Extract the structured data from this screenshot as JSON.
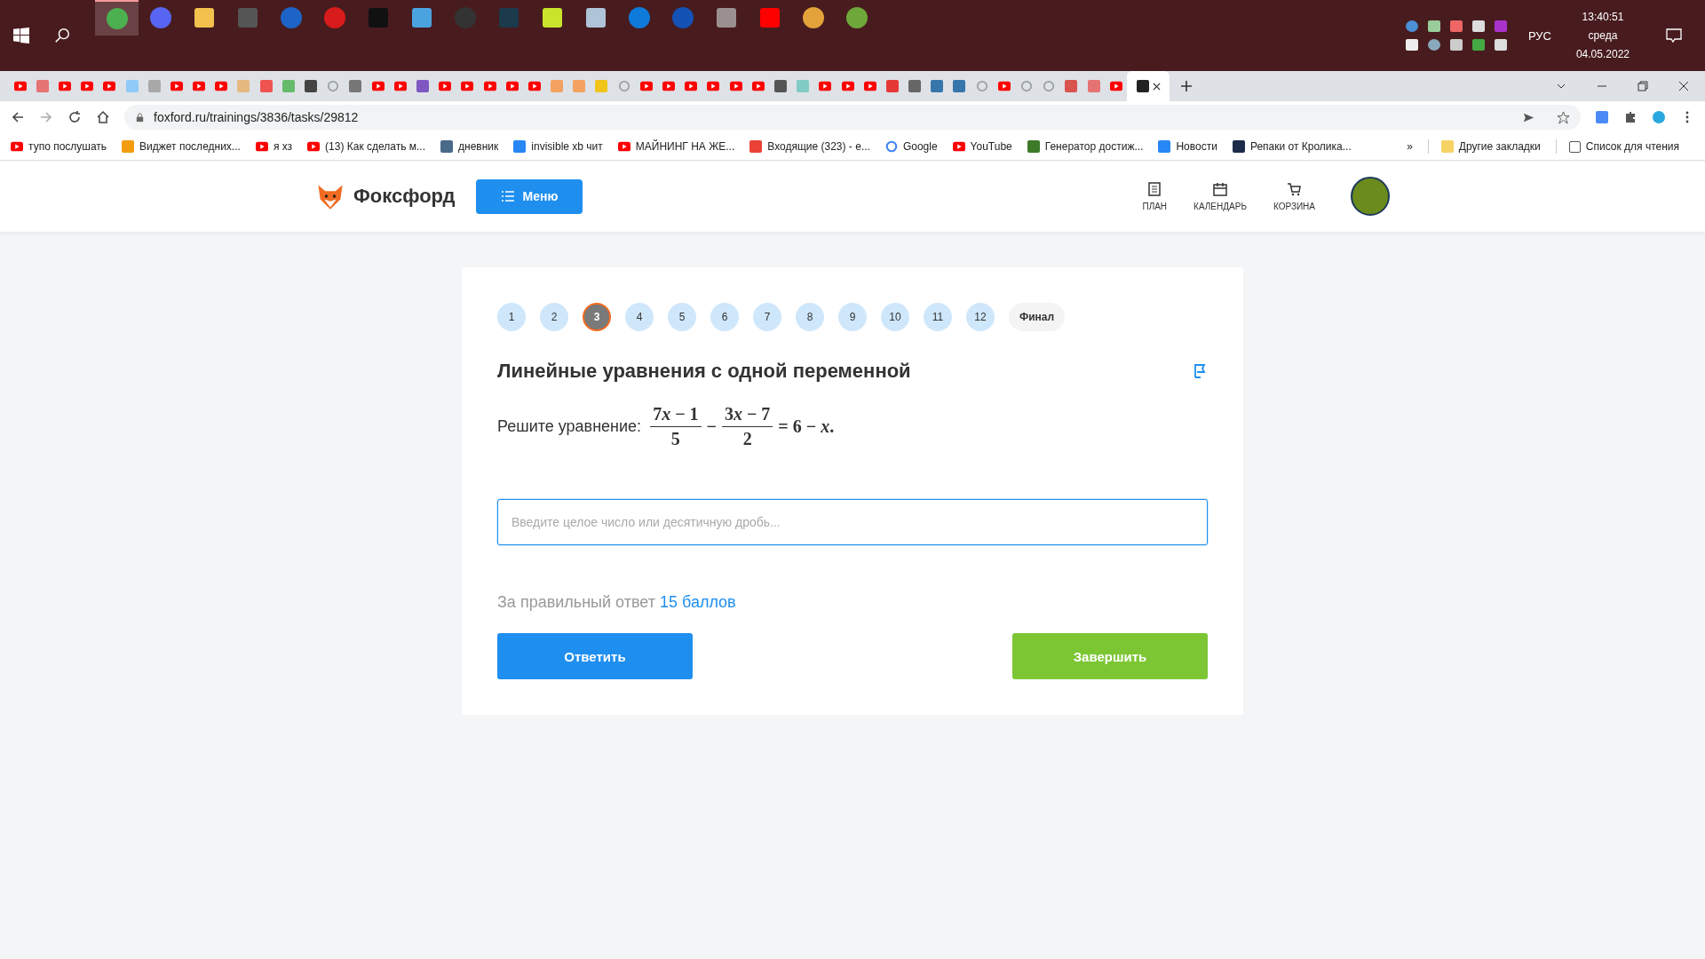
{
  "taskbar": {
    "apps": [
      {
        "kind": "circle",
        "color": "#4caf50",
        "active": true
      },
      {
        "kind": "circle",
        "color": "#5865f2",
        "active": false
      },
      {
        "kind": "square",
        "color": "#f2c14e",
        "active": false
      },
      {
        "kind": "square",
        "color": "#555555",
        "active": false
      },
      {
        "kind": "circle",
        "color": "#1e63c6",
        "active": false
      },
      {
        "kind": "circle",
        "color": "#d81b1b",
        "active": false
      },
      {
        "kind": "square",
        "color": "#111111",
        "active": false
      },
      {
        "kind": "square",
        "color": "#4aa3df",
        "active": false
      },
      {
        "kind": "circle",
        "color": "#333333",
        "active": false
      },
      {
        "kind": "square",
        "color": "#1b3a4b",
        "active": false
      },
      {
        "kind": "square",
        "color": "#c9e52b",
        "active": false
      },
      {
        "kind": "square",
        "color": "#b0c4d8",
        "active": false
      },
      {
        "kind": "circle",
        "color": "#0e7ad9",
        "active": false
      },
      {
        "kind": "circle",
        "color": "#1452b5",
        "active": false
      },
      {
        "kind": "square",
        "color": "#9b8f8f",
        "active": false
      },
      {
        "kind": "square",
        "color": "#ff0000",
        "active": false
      },
      {
        "kind": "circle",
        "color": "#e3a33a",
        "active": false
      },
      {
        "kind": "circle",
        "color": "#6fa83a",
        "active": false
      }
    ],
    "language": "РУС",
    "time": "13:40:51",
    "weekday": "среда",
    "date": "04.05.2022"
  },
  "browser": {
    "tabs": [
      {
        "kind": "youtube",
        "selected": false
      },
      {
        "kind": "site",
        "color": "#e57373",
        "selected": false
      },
      {
        "kind": "youtube",
        "selected": false
      },
      {
        "kind": "youtube",
        "selected": false
      },
      {
        "kind": "youtube",
        "selected": false
      },
      {
        "kind": "site",
        "color": "#90caf9",
        "selected": false
      },
      {
        "kind": "site",
        "color": "#a8a8a8",
        "selected": false
      },
      {
        "kind": "youtube",
        "selected": false
      },
      {
        "kind": "youtube",
        "selected": false
      },
      {
        "kind": "youtube",
        "selected": false
      },
      {
        "kind": "site",
        "color": "#e6b980",
        "selected": false
      },
      {
        "kind": "site",
        "color": "#ef5350",
        "selected": false
      },
      {
        "kind": "site",
        "color": "#66bb6a",
        "selected": false
      },
      {
        "kind": "site",
        "color": "#444444",
        "selected": false
      },
      {
        "kind": "google",
        "selected": false
      },
      {
        "kind": "site",
        "color": "#777777",
        "selected": false
      },
      {
        "kind": "youtube",
        "selected": false
      },
      {
        "kind": "youtube",
        "selected": false
      },
      {
        "kind": "site",
        "color": "#7e57c2",
        "selected": false
      },
      {
        "kind": "youtube",
        "selected": false
      },
      {
        "kind": "youtube",
        "selected": false
      },
      {
        "kind": "youtube",
        "selected": false
      },
      {
        "kind": "youtube",
        "selected": false
      },
      {
        "kind": "youtube",
        "selected": false
      },
      {
        "kind": "site",
        "color": "#f4a261",
        "selected": false
      },
      {
        "kind": "site",
        "color": "#f4a261",
        "selected": false
      },
      {
        "kind": "site",
        "color": "#f0c419",
        "selected": false
      },
      {
        "kind": "google",
        "selected": false
      },
      {
        "kind": "youtube",
        "selected": false
      },
      {
        "kind": "youtube",
        "selected": false
      },
      {
        "kind": "youtube",
        "selected": false
      },
      {
        "kind": "youtube",
        "selected": false
      },
      {
        "kind": "youtube",
        "selected": false
      },
      {
        "kind": "youtube",
        "selected": false
      },
      {
        "kind": "site",
        "color": "#555555",
        "selected": false
      },
      {
        "kind": "site",
        "color": "#80cbc4",
        "selected": false
      },
      {
        "kind": "youtube",
        "selected": false
      },
      {
        "kind": "youtube",
        "selected": false
      },
      {
        "kind": "youtube",
        "selected": false
      },
      {
        "kind": "site",
        "color": "#e53935",
        "selected": false
      },
      {
        "kind": "site",
        "color": "#666666",
        "selected": false
      },
      {
        "kind": "site",
        "color": "#3776ab",
        "selected": false
      },
      {
        "kind": "site",
        "color": "#3776ab",
        "selected": false
      },
      {
        "kind": "google",
        "selected": false
      },
      {
        "kind": "youtube",
        "selected": false
      },
      {
        "kind": "google",
        "selected": false
      },
      {
        "kind": "google",
        "selected": false
      },
      {
        "kind": "site",
        "color": "#d9534f",
        "selected": false
      },
      {
        "kind": "site",
        "color": "#e57373",
        "selected": false
      },
      {
        "kind": "youtube",
        "selected": false
      },
      {
        "kind": "site",
        "color": "#222222",
        "selected": true
      }
    ],
    "address": "foxford.ru/trainings/3836/tasks/29812",
    "bookmarks": [
      {
        "kind": "youtube",
        "label": "тупо послушать"
      },
      {
        "kind": "site",
        "color": "#f39c12",
        "label": "Виджет последних..."
      },
      {
        "kind": "youtube",
        "label": "я хз"
      },
      {
        "kind": "youtube",
        "label": "(13) Как сделать м..."
      },
      {
        "kind": "site",
        "color": "#4a6a8a",
        "label": "дневник"
      },
      {
        "kind": "site",
        "color": "#2787f5",
        "label": "invisible xb чит"
      },
      {
        "kind": "youtube",
        "label": "МАЙНИНГ НА ЖЕ..."
      },
      {
        "kind": "site",
        "color": "#ea4335",
        "label": "Входящие (323) - е..."
      },
      {
        "kind": "google",
        "label": "Google"
      },
      {
        "kind": "youtube",
        "label": "YouTube"
      },
      {
        "kind": "site",
        "color": "#3d7a2a",
        "label": "Генератор достиж..."
      },
      {
        "kind": "site",
        "color": "#2787f5",
        "label": "Новости"
      },
      {
        "kind": "site",
        "color": "#1c2b4a",
        "label": "Репаки от Кролика..."
      }
    ],
    "more": "»",
    "other_bookmarks": "Другие закладки",
    "reading_list": "Список для чтения"
  },
  "header": {
    "logo": "Фоксфорд",
    "menu": "Меню",
    "nav": [
      "ПЛАН",
      "КАЛЕНДАРЬ",
      "КОРЗИНА"
    ]
  },
  "tasks": [
    {
      "label": "1",
      "selected": false
    },
    {
      "label": "2",
      "selected": false
    },
    {
      "label": "3",
      "selected": true
    },
    {
      "label": "4",
      "selected": false
    },
    {
      "label": "5",
      "selected": false
    },
    {
      "label": "6",
      "selected": false
    },
    {
      "label": "7",
      "selected": false
    },
    {
      "label": "8",
      "selected": false
    },
    {
      "label": "9",
      "selected": false
    },
    {
      "label": "10",
      "selected": false
    },
    {
      "label": "11",
      "selected": false
    },
    {
      "label": "12",
      "selected": false
    },
    {
      "label": "Финал",
      "selected": false
    }
  ],
  "problem": {
    "title": "Линейные уравнения с одной переменной",
    "prompt": "Решите уравнение:",
    "fractions": [
      {
        "coefficient": "7",
        "variable": "x",
        "rest": "− 1",
        "denominator": "5"
      },
      {
        "coefficient": "3",
        "variable": "x",
        "rest": "− 7",
        "denominator": "2"
      }
    ],
    "operator": "−",
    "rhs": {
      "text": "= 6 −",
      "variable": "x",
      "end": "."
    },
    "placeholder": "Введите целое число или десятичную дробь...",
    "reward_text": "За правильный ответ",
    "reward_points": "15 баллов",
    "answer": "Ответить",
    "finish": "Завершить"
  }
}
